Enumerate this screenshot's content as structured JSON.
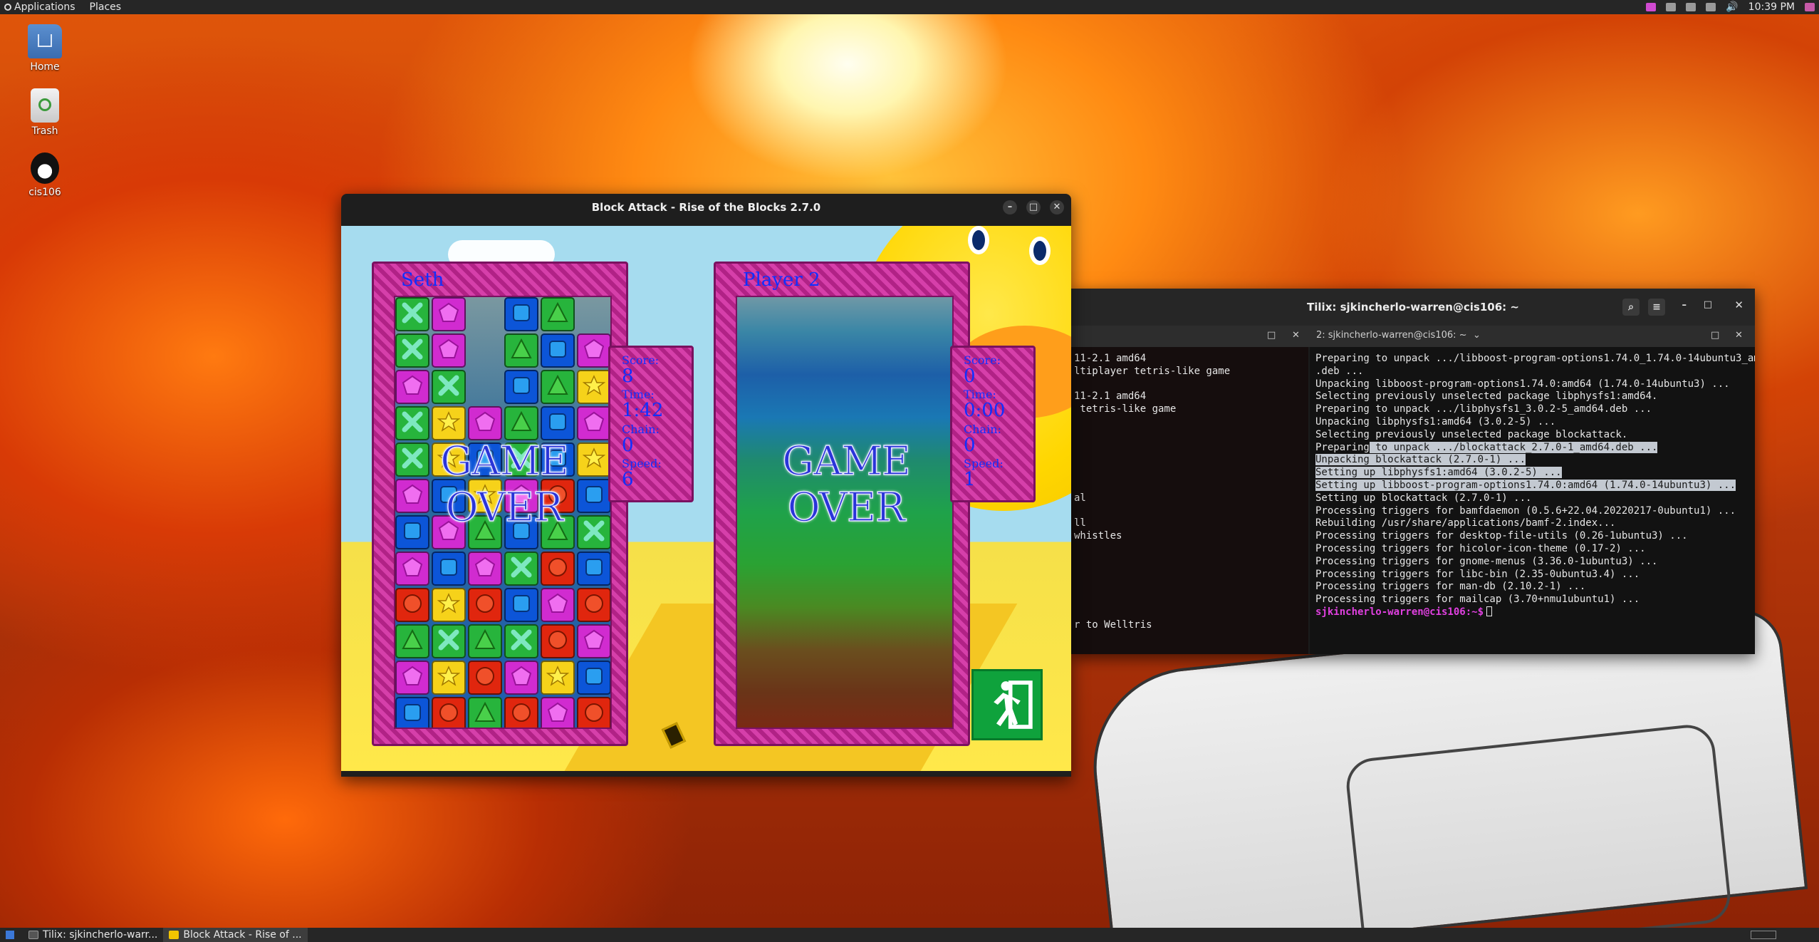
{
  "top_panel": {
    "applications_label": "Applications",
    "places_label": "Places",
    "clock": "10:39 PM"
  },
  "desktop_icons": [
    {
      "label": "Home",
      "icon": "home-folder-icon"
    },
    {
      "label": "Trash",
      "icon": "trash-icon"
    },
    {
      "label": "cis106",
      "icon": "penguin-icon"
    }
  ],
  "game_window": {
    "title": "Block Attack - Rise of the Blocks 2.7.0",
    "player1": {
      "name": "Seth",
      "score_label": "Score:",
      "score": "8",
      "time_label": "Time:",
      "time": "1:42",
      "chain_label": "Chain:",
      "chain": "0",
      "speed_label": "Speed:",
      "speed": "6"
    },
    "player2": {
      "name": "Player 2",
      "score_label": "Score:",
      "score": "0",
      "time_label": "Time:",
      "time": "0:00",
      "chain_label": "Chain:",
      "chain": "0",
      "speed_label": "Speed:",
      "speed": "1"
    },
    "game_over_line1": "GAME",
    "game_over_line2": "OVER",
    "board1_rows": [
      [
        "GX",
        "MP",
        "__",
        "BS",
        "GT",
        "__"
      ],
      [
        "GX",
        "MP",
        "__",
        "GT",
        "BS",
        "MP"
      ],
      [
        "MP",
        "GX",
        "__",
        "BS",
        "GT",
        "YS"
      ],
      [
        "GX",
        "YS",
        "MP",
        "GT",
        "BS",
        "MP"
      ],
      [
        "GX",
        "YS",
        "BS",
        "GX",
        "BS",
        "YS"
      ],
      [
        "MP",
        "BS",
        "YS",
        "MP",
        "RC",
        "BS"
      ],
      [
        "BS",
        "MP",
        "GT",
        "BS",
        "GT",
        "GX"
      ],
      [
        "MP",
        "BS",
        "MP",
        "GX",
        "RC",
        "BS"
      ],
      [
        "RC",
        "YS",
        "RC",
        "BS",
        "MP",
        "RC"
      ],
      [
        "GT",
        "GX",
        "GT",
        "GX",
        "RC",
        "MP"
      ],
      [
        "MP",
        "YS",
        "RC",
        "MP",
        "YS",
        "BS"
      ],
      [
        "BS",
        "RC",
        "GT",
        "RC",
        "MP",
        "RC"
      ]
    ],
    "colors": {
      "block_green": "#27b43c",
      "block_magenta": "#d12bd0",
      "block_blue": "#0c55d8",
      "block_yellow": "#f6d21a",
      "block_red": "#e0260e",
      "frame_pink": "#d63faa",
      "label_blue": "#1030ff",
      "exit_green": "#0fa23c"
    },
    "exit_icon": "exit-running-man-icon"
  },
  "terminal": {
    "title": "Tilix: sjkincherlo-warren@cis106: ~",
    "tab2_label": "2: sjkincherlo-warren@cis106: ~",
    "left_lines": [
      "11-2.1 amd64",
      "ltiplayer tetris-like game",
      "",
      "11-2.1 amd64",
      " tetris-like game",
      "",
      "",
      "",
      "",
      "",
      "",
      "al",
      "",
      "ll",
      "whistles",
      "",
      "",
      "",
      "",
      "",
      "",
      "r to Welltris"
    ],
    "right_lines": [
      "Preparing to unpack .../libboost-program-options1.74.0_1.74.0-14ubuntu3_amd64",
      ".deb ...",
      "Unpacking libboost-program-options1.74.0:amd64 (1.74.0-14ubuntu3) ...",
      "Selecting previously unselected package libphysfs1:amd64.",
      "Preparing to unpack .../libphysfs1_3.0.2-5_amd64.deb ...",
      "Unpacking libphysfs1:amd64 (3.0.2-5) ...",
      "Selecting previously unselected package blockattack.",
      "Preparing to unpack .../blockattack_2.7.0-1_amd64.deb ...",
      "Unpacking blockattack (2.7.0-1) ...",
      "Setting up libphysfs1:amd64 (3.0.2-5) ...",
      "Setting up libboost-program-options1.74.0:amd64 (1.74.0-14ubuntu3) ...",
      "Setting up blockattack (2.7.0-1) ...",
      "Processing triggers for bamfdaemon (0.5.6+22.04.20220217-0ubuntu1) ...",
      "Rebuilding /usr/share/applications/bamf-2.index...",
      "Processing triggers for desktop-file-utils (0.26-1ubuntu3) ...",
      "Processing triggers for hicolor-icon-theme (0.17-2) ...",
      "Processing triggers for gnome-menus (3.36.0-1ubuntu3) ...",
      "Processing triggers for libc-bin (2.35-0ubuntu3.4) ...",
      "Processing triggers for man-db (2.10.2-1) ...",
      "Processing triggers for mailcap (3.70+nmu1ubuntu1) ..."
    ],
    "prompt": "sjkincherlo-warren@cis106:~$"
  },
  "taskbar": {
    "items": [
      {
        "label": "Tilix: sjkincherlo-warr...",
        "icon": "terminal-icon"
      },
      {
        "label": "Block Attack - Rise of ...",
        "icon": "game-icon"
      }
    ]
  }
}
